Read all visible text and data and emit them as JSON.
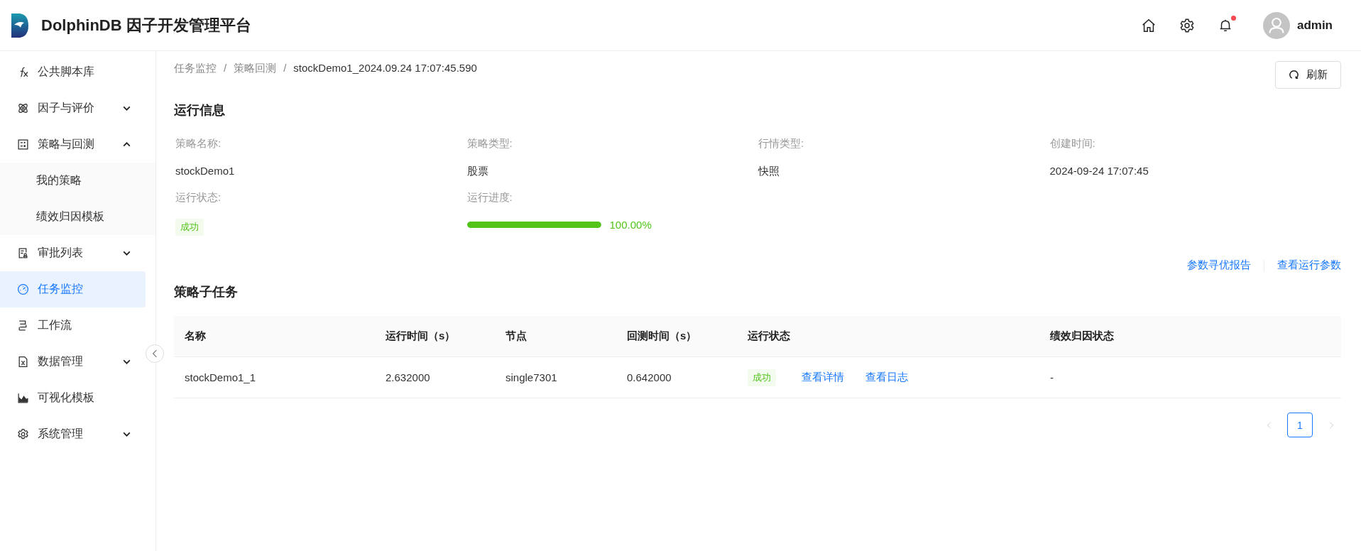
{
  "header": {
    "brand": "DolphinDB 因子开发管理平台",
    "bell_unread": true,
    "user": "admin"
  },
  "sidebar": {
    "items": [
      {
        "label": "公共脚本库",
        "selected": false
      },
      {
        "label": "因子与评价",
        "selected": false,
        "expanded": false
      },
      {
        "label": "策略与回测",
        "selected": false,
        "expanded": true,
        "children": [
          {
            "label": "我的策略",
            "selected": false
          },
          {
            "label": "绩效归因模板",
            "selected": false
          }
        ]
      },
      {
        "label": "审批列表",
        "selected": false,
        "expanded": false
      },
      {
        "label": "任务监控",
        "selected": true
      },
      {
        "label": "工作流",
        "selected": false
      },
      {
        "label": "数据管理",
        "selected": false,
        "expanded": false
      },
      {
        "label": "可视化模板",
        "selected": false
      },
      {
        "label": "系统管理",
        "selected": false,
        "expanded": false
      }
    ]
  },
  "breadcrumb": {
    "items": [
      "任务监控",
      "策略回测",
      "stockDemo1_2024.09.24 17:07:45.590"
    ],
    "separators": [
      "/",
      "/"
    ]
  },
  "refresh_button": "刷新",
  "run_info": {
    "title": "运行信息",
    "fields": [
      {
        "kind": "text",
        "label": "策略名称:",
        "value": "stockDemo1"
      },
      {
        "kind": "text",
        "label": "策略类型:",
        "value": "股票"
      },
      {
        "kind": "text",
        "label": "行情类型:",
        "value": "快照"
      },
      {
        "kind": "text",
        "label": "创建时间:",
        "value": "2024-09-24 17:07:45"
      },
      {
        "kind": "tag",
        "label": "运行状态:",
        "value": "成功"
      },
      {
        "kind": "progress",
        "label": "运行进度:",
        "value": "100.00%",
        "level": 1.0
      }
    ]
  },
  "actions": [
    "参数寻优报告",
    "查看运行参数"
  ],
  "subtasks": {
    "title": "策略子任务",
    "columns": [
      "名称",
      "运行时间（s）",
      "节点",
      "回测时间（s）",
      "运行状态",
      "绩效归因状态"
    ],
    "rows": [
      {
        "name": "stockDemo1_1",
        "run_time": "2.632000",
        "node": "single7301",
        "backtest_time": "0.642000",
        "status": "成功",
        "links": [
          "查看详情",
          "查看日志"
        ],
        "attribution": "-"
      }
    ]
  },
  "pagination": {
    "prev_disabled": true,
    "next_disabled": true,
    "pages": [
      {
        "label": "1",
        "selected": true
      }
    ]
  }
}
